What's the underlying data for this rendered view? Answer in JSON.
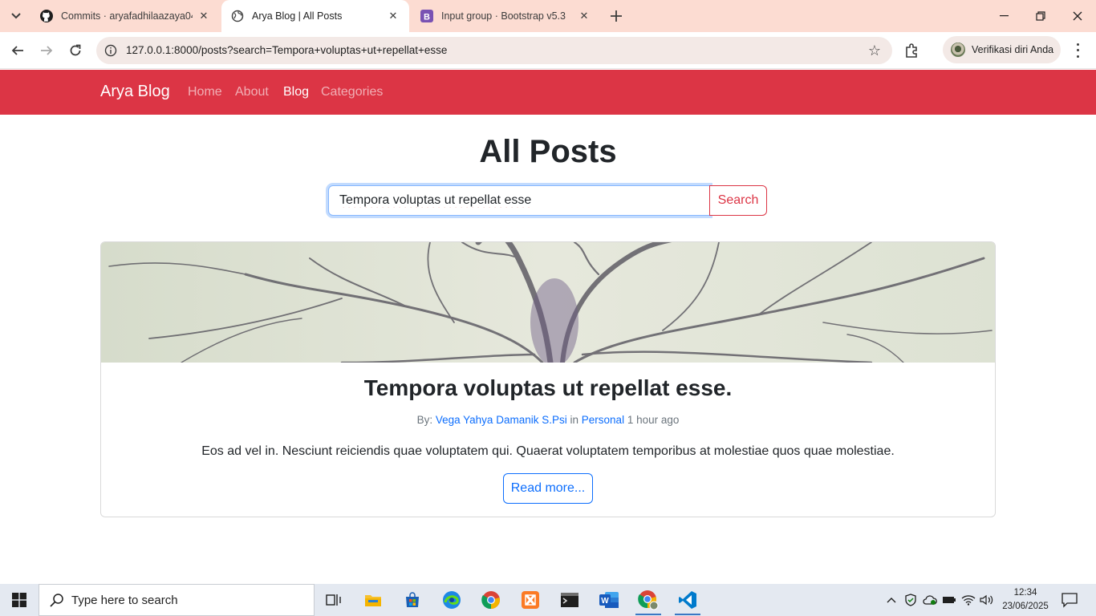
{
  "browser": {
    "tabs": [
      {
        "title": "Commits · aryafadhilaazaya04/L",
        "favicon": "github-icon",
        "active": false
      },
      {
        "title": "Arya Blog | All Posts",
        "favicon": "globe-icon",
        "active": true
      },
      {
        "title": "Input group · Bootstrap v5.3",
        "favicon": "bootstrap-icon",
        "active": false
      }
    ],
    "url": "127.0.0.1:8000/posts?search=Tempora+voluptas+ut+repellat+esse",
    "profile_label": "Verifikasi diri Anda"
  },
  "navbar": {
    "brand": "Arya Blog",
    "links": [
      {
        "label": "Home",
        "active": false
      },
      {
        "label": "About",
        "active": false
      },
      {
        "label": "Blog",
        "active": true
      },
      {
        "label": "Categories",
        "active": false
      }
    ],
    "color": "#dc3545"
  },
  "main": {
    "title": "All Posts",
    "search": {
      "value": "Tempora voluptas ut repellat esse",
      "button": "Search"
    },
    "post": {
      "title": "Tempora voluptas ut repellat esse.",
      "meta_prefix": "By:",
      "author": "Vega Yahya Damanik S.Psi",
      "in_text": "in",
      "category": "Personal",
      "time": "1 hour ago",
      "excerpt": "Eos ad vel in. Nesciunt reiciendis quae voluptatem qui. Quaerat voluptatem temporibus at molestiae quos quae molestiae.",
      "read_more": "Read more..."
    }
  },
  "taskbar": {
    "search_placeholder": "Type here to search",
    "time": "12:34",
    "date": "23/06/2025",
    "apps": [
      "task-view-icon",
      "file-explorer-icon",
      "microsoft-store-icon",
      "edge-icon",
      "chrome-icon",
      "xampp-icon",
      "terminal-icon",
      "word-icon",
      "chrome-profile-icon",
      "vscode-icon"
    ]
  }
}
